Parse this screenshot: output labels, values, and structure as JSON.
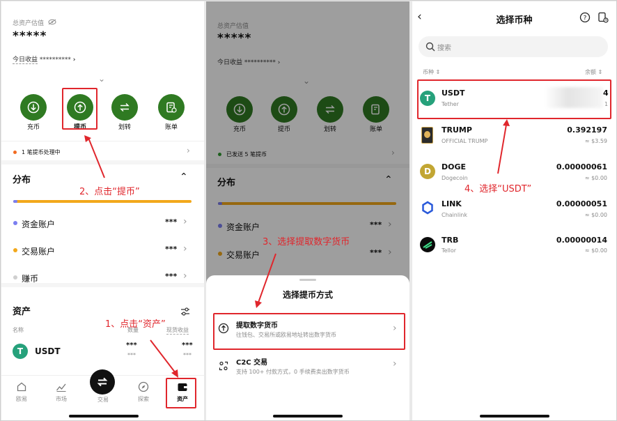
{
  "panel1": {
    "total_label": "总资产估值",
    "total_value": "*****",
    "today_label": "今日收益",
    "today_value": "**********",
    "actions": [
      {
        "label": "充币",
        "icon": "deposit-icon"
      },
      {
        "label": "提币",
        "icon": "withdraw-icon"
      },
      {
        "label": "划转",
        "icon": "transfer-icon"
      },
      {
        "label": "账单",
        "icon": "bill-icon"
      }
    ],
    "pending_notice": "1 笔提币处理中",
    "distribution_title": "分布",
    "accounts": [
      {
        "label": "资金账户",
        "value": "***",
        "color": "#7b7ff0"
      },
      {
        "label": "交易账户",
        "value": "***",
        "color": "#f2a81b"
      },
      {
        "label": "赚币",
        "value": "***",
        "color": "#cfcfcf"
      }
    ],
    "assets_title": "资产",
    "col_name": "名称",
    "col_qty": "数量",
    "col_income": "现货收益",
    "asset_row": {
      "name": "USDT",
      "qty": "***",
      "qty_sub": "***",
      "income": "***",
      "income_sub": "***"
    },
    "tabbar": [
      {
        "label": "欧易",
        "icon": "home-icon"
      },
      {
        "label": "市场",
        "icon": "market-icon"
      },
      {
        "label": "交易",
        "icon": "trade-icon"
      },
      {
        "label": "探索",
        "icon": "explore-icon"
      },
      {
        "label": "资产",
        "icon": "wallet-icon"
      }
    ],
    "annotation_1": "1、点击“资产”",
    "annotation_2": "2、点击“提币”"
  },
  "panel2": {
    "total_label": "总资产估值",
    "total_value": "*****",
    "today_label": "今日收益",
    "today_value": "**********",
    "actions": [
      "充币",
      "提币",
      "划转",
      "账单"
    ],
    "notice": "已发送 5 笔提币",
    "distribution_title": "分布",
    "accounts": [
      {
        "label": "资金账户",
        "value": "***"
      },
      {
        "label": "交易账户",
        "value": "***"
      }
    ],
    "sheet_title": "选择提币方式",
    "option1_title": "提取数字货币",
    "option1_desc": "往钱包、交易所或欧易地址转出数字货币",
    "option2_title": "C2C 交易",
    "option2_desc": "支持 100+ 付款方式，0 手续费卖出数字货币",
    "annotation_3": "3、选择提取数字货币"
  },
  "panel3": {
    "title": "选择币种",
    "search_placeholder": "搜索",
    "col_coin": "币种 ⇕",
    "col_balance": "余额 ⇕",
    "coins": [
      {
        "symbol": "USDT",
        "name": "Tether",
        "balance": "4",
        "usd": "1",
        "color": "#26a17b"
      },
      {
        "symbol": "TRUMP",
        "name": "OFFICIAL TRUMP",
        "balance": "0.392197",
        "usd": "≈ $3.59",
        "color": "#2b2b2b"
      },
      {
        "symbol": "DOGE",
        "name": "Dogecoin",
        "balance": "0.00000061",
        "usd": "≈ $0.00",
        "color": "#c2a633"
      },
      {
        "symbol": "LINK",
        "name": "Chainlink",
        "balance": "0.00000051",
        "usd": "≈ $0.00",
        "color": "#2a5ada"
      },
      {
        "symbol": "TRB",
        "name": "Tellor",
        "balance": "0.00000014",
        "usd": "≈ $0.00",
        "color": "#0b0b0b"
      }
    ],
    "annotation_4": "4、选择“USDT”"
  }
}
